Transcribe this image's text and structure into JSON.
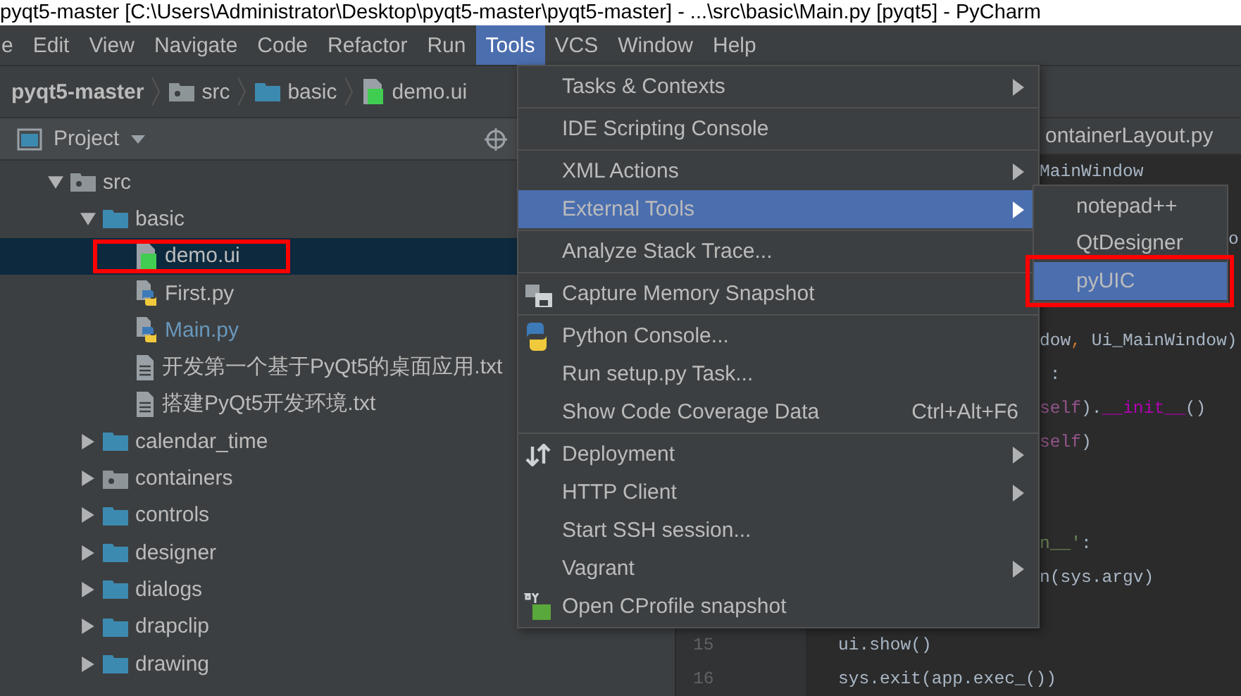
{
  "window": {
    "title": "pyqt5-master [C:\\Users\\Administrator\\Desktop\\pyqt5-master\\pyqt5-master] - ...\\src\\basic\\Main.py [pyqt5] - PyCharm"
  },
  "menu_bar": [
    {
      "label": "e",
      "selected": false
    },
    {
      "label": "Edit",
      "selected": false
    },
    {
      "label": "View",
      "selected": false
    },
    {
      "label": "Navigate",
      "selected": false
    },
    {
      "label": "Code",
      "selected": false
    },
    {
      "label": "Refactor",
      "selected": false
    },
    {
      "label": "Run",
      "selected": false
    },
    {
      "label": "Tools",
      "selected": true
    },
    {
      "label": "VCS",
      "selected": false
    },
    {
      "label": "Window",
      "selected": false
    },
    {
      "label": "Help",
      "selected": false
    }
  ],
  "breadcrumb": [
    {
      "label": "pyqt5-master",
      "kind": "project"
    },
    {
      "label": "src",
      "kind": "package"
    },
    {
      "label": "basic",
      "kind": "folder"
    },
    {
      "label": "demo.ui",
      "kind": "qt"
    }
  ],
  "project_panel": {
    "title": "Project",
    "tree": [
      {
        "label": "src",
        "kind": "package",
        "expanded": true,
        "selected": false,
        "children": [
          {
            "label": "basic",
            "kind": "folder",
            "expanded": true,
            "selected": false,
            "children": [
              {
                "label": "demo.ui",
                "kind": "qt",
                "selected": true,
                "highlighted": true
              },
              {
                "label": "First.py",
                "kind": "python",
                "selected": false
              },
              {
                "label": "Main.py",
                "kind": "python",
                "selected": false,
                "modified": true
              },
              {
                "label": "开发第一个基于PyQt5的桌面应用.txt",
                "kind": "text",
                "selected": false
              },
              {
                "label": "搭建PyQt5开发环境.txt",
                "kind": "text",
                "selected": false
              }
            ]
          },
          {
            "label": "calendar_time",
            "kind": "folder",
            "expanded": false,
            "selected": false
          },
          {
            "label": "containers",
            "kind": "package",
            "expanded": false,
            "selected": false
          },
          {
            "label": "controls",
            "kind": "folder",
            "expanded": false,
            "selected": false
          },
          {
            "label": "designer",
            "kind": "folder",
            "expanded": false,
            "selected": false
          },
          {
            "label": "dialogs",
            "kind": "folder",
            "expanded": false,
            "selected": false
          },
          {
            "label": "drapclip",
            "kind": "folder",
            "expanded": false,
            "selected": false
          },
          {
            "label": "drawing",
            "kind": "folder",
            "expanded": false,
            "selected": false
          }
        ]
      }
    ]
  },
  "editor": {
    "tab": "ontainerLayout.py",
    "lines": [
      {
        "kind": "behind_menu",
        "segments": [
          {
            "text": "MainWindow",
            "kind": "plain"
          }
        ]
      },
      {
        "kind": "behind_submenu",
        "segments": [
          {
            "text": "o",
            "kind": "plain"
          }
        ]
      },
      {
        "kind": "behind_menu",
        "segments": [
          {
            "text": "dow",
            "kind": "plain"
          },
          {
            "text": ",",
            "kind": "punct"
          },
          {
            "text": " Ui_MainWindow)",
            "kind": "plain"
          }
        ]
      },
      {
        "kind": "behind_menu",
        "segments": [
          {
            "text": " :",
            "kind": "plain"
          }
        ]
      },
      {
        "kind": "behind_menu",
        "segments": [
          {
            "text": "self",
            "kind": "self"
          },
          {
            "text": ").",
            "kind": "plain"
          },
          {
            "text": "__init__",
            "kind": "magic"
          },
          {
            "text": "()",
            "kind": "plain"
          }
        ]
      },
      {
        "kind": "behind_menu",
        "segments": [
          {
            "text": "self",
            "kind": "self"
          },
          {
            "text": ")",
            "kind": "plain"
          }
        ]
      },
      {
        "kind": "behind_menu",
        "segments": [
          {
            "text": "n__'",
            "kind": "string"
          },
          {
            "text": ":",
            "kind": "plain"
          }
        ]
      },
      {
        "kind": "behind_menu",
        "segments": [
          {
            "text": "n(sys.argv)",
            "kind": "plain"
          }
        ]
      },
      {
        "kind": "numbered",
        "number": "15",
        "segments": [
          {
            "text": "ui.show()",
            "kind": "plain"
          }
        ]
      },
      {
        "kind": "numbered",
        "number": "16",
        "segments": [
          {
            "text": "sys.exit(app.exec_())",
            "kind": "plain"
          }
        ]
      }
    ]
  },
  "tools_menu": {
    "groups": [
      [
        {
          "label": "Tasks & Contexts",
          "submenu": true,
          "selected": false
        }
      ],
      [
        {
          "label": "IDE Scripting Console",
          "submenu": false,
          "selected": false
        }
      ],
      [
        {
          "label": "XML Actions",
          "submenu": true,
          "selected": false
        },
        {
          "label": "External Tools",
          "submenu": true,
          "selected": true
        }
      ],
      [
        {
          "label": "Analyze Stack Trace...",
          "submenu": false,
          "selected": false
        }
      ],
      [
        {
          "label": "Capture Memory Snapshot",
          "submenu": false,
          "selected": false
        }
      ],
      [
        {
          "label": "Python Console...",
          "submenu": false,
          "selected": false
        },
        {
          "label": "Run setup.py Task...",
          "submenu": false,
          "selected": false
        },
        {
          "label": "Show Code Coverage Data",
          "shortcut": "Ctrl+Alt+F6",
          "submenu": false,
          "selected": false
        }
      ],
      [
        {
          "label": "Deployment",
          "submenu": true,
          "selected": false
        },
        {
          "label": "HTTP Client",
          "submenu": true,
          "selected": false
        },
        {
          "label": "Start SSH session...",
          "submenu": false,
          "selected": false
        },
        {
          "label": "Vagrant",
          "submenu": true,
          "selected": false
        },
        {
          "label": "Open CProfile snapshot",
          "submenu": false,
          "selected": false
        }
      ]
    ]
  },
  "external_tools_submenu": [
    {
      "label": "notepad++",
      "selected": false,
      "highlighted": false
    },
    {
      "label": "QtDesigner",
      "selected": false,
      "highlighted": false
    },
    {
      "label": "pyUIC",
      "selected": true,
      "highlighted": true
    }
  ]
}
